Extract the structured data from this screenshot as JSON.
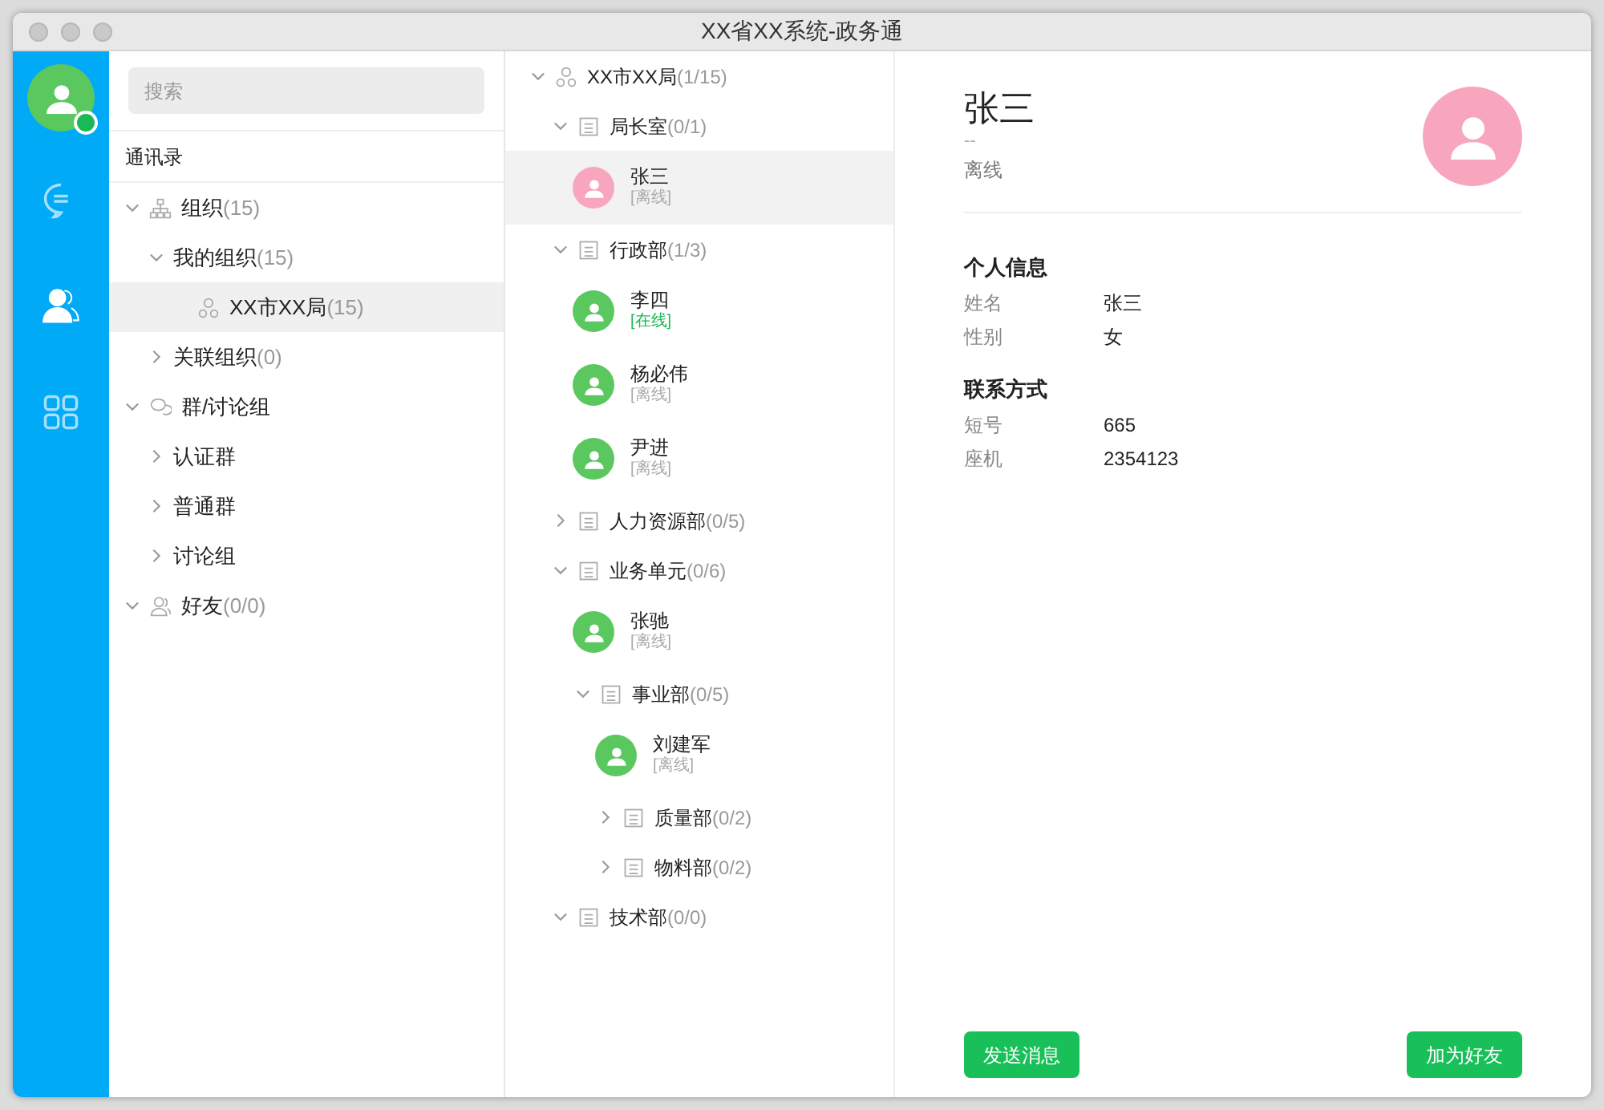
{
  "window": {
    "title": "XX省XX系统-政务通"
  },
  "rail": {
    "online": true,
    "items": [
      {
        "kind": "chat",
        "selected": false
      },
      {
        "kind": "contacts",
        "selected": true
      },
      {
        "kind": "apps",
        "selected": false
      }
    ]
  },
  "search": {
    "placeholder": "搜索"
  },
  "nav_title": "通讯录",
  "nav_tree": [
    {
      "kind": "org",
      "label": "组织",
      "count": "(15)",
      "expanded": true,
      "selected": false,
      "children": [
        {
          "label": "我的组织",
          "count": "(15)",
          "expanded": true,
          "selected": false,
          "children": [
            {
              "kind": "unit",
              "label": "XX市XX局",
              "count": "(15)",
              "selected": true
            }
          ]
        },
        {
          "label": "关联组织",
          "count": "(0)",
          "expanded": false,
          "selected": false
        }
      ]
    },
    {
      "kind": "chat",
      "label": "群/讨论组",
      "expanded": true,
      "selected": false,
      "children": [
        {
          "label": "认证群",
          "expanded": false,
          "selected": false
        },
        {
          "label": "普通群",
          "expanded": false,
          "selected": false
        },
        {
          "label": "讨论组",
          "expanded": false,
          "selected": false
        }
      ]
    },
    {
      "kind": "friends",
      "label": "好友",
      "count": "(0/0)",
      "expanded": true,
      "selected": false
    }
  ],
  "org_tree": [
    {
      "kind": "unit",
      "label": "XX市XX局",
      "count": "(1/15)",
      "expanded": true,
      "children": [
        {
          "kind": "dept",
          "label": "局长室",
          "count": "(0/1)",
          "expanded": true,
          "children": [
            {
              "kind": "person",
              "name": "张三",
              "status": "[离线]",
              "online": false,
              "color": "#f7a6be",
              "selected": true
            }
          ]
        },
        {
          "kind": "dept",
          "label": "行政部",
          "count": "(1/3)",
          "expanded": true,
          "children": [
            {
              "kind": "person",
              "name": "李四",
              "status": "[在线]",
              "online": true,
              "color": "#5ac85f",
              "selected": false
            },
            {
              "kind": "person",
              "name": "杨必伟",
              "status": "[离线]",
              "online": false,
              "color": "#5ac85f",
              "selected": false
            },
            {
              "kind": "person",
              "name": "尹进",
              "status": "[离线]",
              "online": false,
              "color": "#5ac85f",
              "selected": false
            }
          ]
        },
        {
          "kind": "dept",
          "label": "人力资源部",
          "count": "(0/5)",
          "expanded": false
        },
        {
          "kind": "dept",
          "label": "业务单元",
          "count": "(0/6)",
          "expanded": true,
          "children": [
            {
              "kind": "person",
              "name": "张驰",
              "status": "[离线]",
              "online": false,
              "color": "#5ac85f",
              "selected": false
            },
            {
              "kind": "dept",
              "label": "事业部",
              "count": "(0/5)",
              "expanded": true,
              "children": [
                {
                  "kind": "person",
                  "name": "刘建军",
                  "status": "[离线]",
                  "online": false,
                  "color": "#5ac85f",
                  "selected": false
                },
                {
                  "kind": "dept",
                  "label": "质量部",
                  "count": "(0/2)",
                  "expanded": false
                },
                {
                  "kind": "dept",
                  "label": "物料部",
                  "count": "(0/2)",
                  "expanded": false
                }
              ]
            }
          ]
        },
        {
          "kind": "dept",
          "label": "技术部",
          "count": "(0/0)",
          "expanded": true
        }
      ]
    }
  ],
  "detail": {
    "name": "张三",
    "subtitle": "--",
    "status": "离线",
    "color": "#f7a6be",
    "sections": [
      {
        "title": "个人信息",
        "fields": [
          {
            "label": "姓名",
            "value": "张三"
          },
          {
            "label": "性别",
            "value": "女"
          }
        ]
      },
      {
        "title": "联系方式",
        "fields": [
          {
            "label": "短号",
            "value": "665"
          },
          {
            "label": "座机",
            "value": "2354123"
          }
        ]
      }
    ],
    "buttons": [
      "发送消息",
      "加为好友"
    ]
  }
}
